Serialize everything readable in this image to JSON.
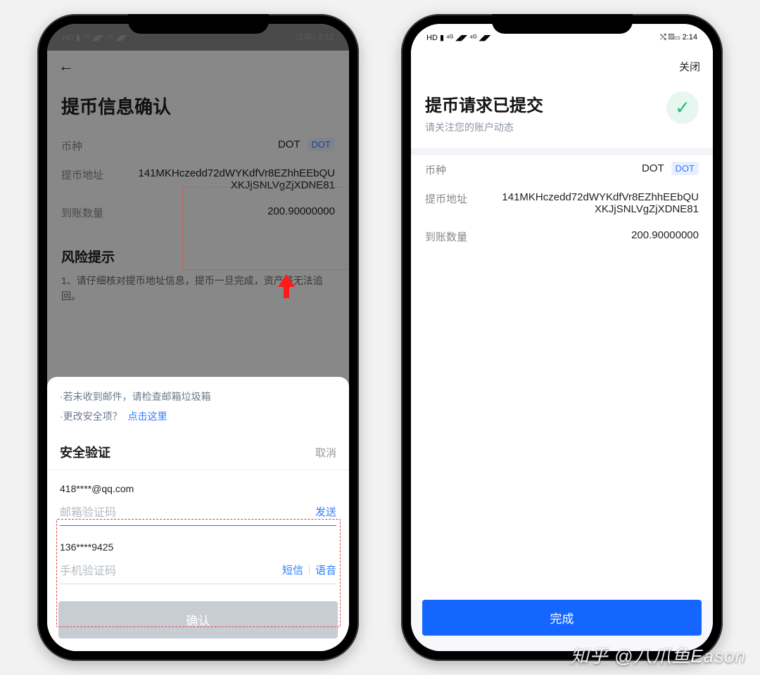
{
  "left": {
    "status": {
      "left_icons": "HD ▮ ⁴ᴳ ◢◤ ⁴ᴳ ◢◤",
      "right": "⤭  ▧▭  2:12"
    },
    "page_title": "提币信息确认",
    "fields": {
      "coin_label": "币种",
      "coin_value": "DOT",
      "coin_chip": "DOT",
      "address_label": "提币地址",
      "address_value": "141MKHczedd72dWYKdfVr8EZhhEEbQUXKJjSNLVgZjXDNE81",
      "amount_label": "到账数量",
      "amount_value": "200.90000000"
    },
    "risk": {
      "title": "风险提示",
      "line1": "1、请仔细核对提币地址信息，提币一旦完成，资产将无法追回。"
    },
    "sheet": {
      "hint1": "·若未收到邮件，请检查邮箱垃圾箱",
      "hint2_prefix": "·更改安全项？",
      "hint2_link": "点击这里",
      "title": "安全验证",
      "cancel": "取消",
      "email_label": "418****@qq.com",
      "email_placeholder": "邮箱验证码",
      "email_action": "发送",
      "phone_label": "136****9425",
      "phone_placeholder": "手机验证码",
      "sms": "短信",
      "voice": "语音",
      "confirm": "确认"
    }
  },
  "right": {
    "status": {
      "left_icons": "HD ▮ ⁴ᴳ ◢◤ ⁴ᴳ ◢◤",
      "right": "⤭  ▧▭  2:14"
    },
    "close": "关闭",
    "title": "提币请求已提交",
    "subtitle": "请关注您的账户动态",
    "fields": {
      "coin_label": "币种",
      "coin_value": "DOT",
      "coin_chip": "DOT",
      "address_label": "提币地址",
      "address_value": "141MKHczedd72dWYKdfVr8EZhhEEbQUXKJjSNLVgZjXDNE81",
      "amount_label": "到账数量",
      "amount_value": "200.90000000"
    },
    "done": "完成"
  },
  "watermark": "知乎 @八爪鱼Eason"
}
